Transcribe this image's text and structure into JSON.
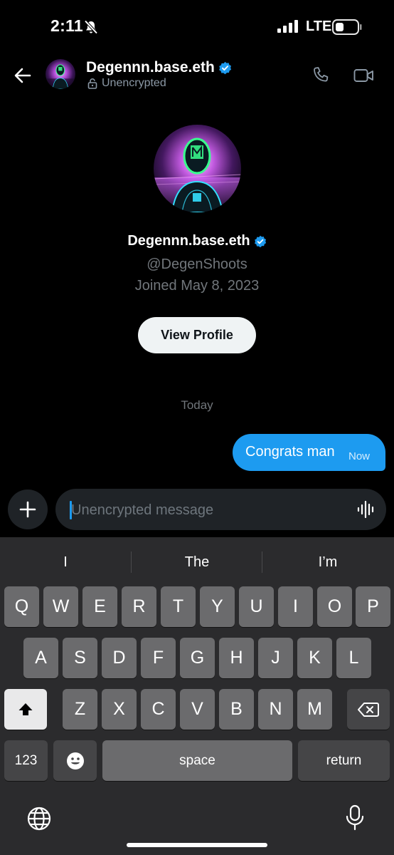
{
  "status": {
    "time": "2:11",
    "network": "LTE",
    "icons": [
      "bell-slash-icon",
      "signal-icon",
      "battery-icon"
    ]
  },
  "header": {
    "name": "Degennn.base.eth",
    "encryption": "Unencrypted",
    "icons": [
      "back-arrow-icon",
      "verified-badge-icon",
      "lock-icon",
      "phone-icon",
      "video-camera-icon"
    ]
  },
  "profile": {
    "name": "Degennn.base.eth",
    "handle": "@DegenShoots",
    "joined": "Joined May 8, 2023",
    "view_profile_label": "View Profile"
  },
  "conversation": {
    "day_label": "Today",
    "messages": [
      {
        "text": "Congrats man",
        "time": "Now",
        "from_me": true
      }
    ]
  },
  "composer": {
    "placeholder": "Unencrypted message",
    "icons": [
      "plus-icon",
      "voice-wave-icon"
    ]
  },
  "keyboard": {
    "suggestions": [
      "I",
      "The",
      "I’m"
    ],
    "row1": [
      "Q",
      "W",
      "E",
      "R",
      "T",
      "Y",
      "U",
      "I",
      "O",
      "P"
    ],
    "row2": [
      "A",
      "S",
      "D",
      "F",
      "G",
      "H",
      "J",
      "K",
      "L"
    ],
    "row3": [
      "Z",
      "X",
      "C",
      "V",
      "B",
      "N",
      "M"
    ],
    "numbers_label": "123",
    "space_label": "space",
    "return_label": "return",
    "icons": [
      "shift-icon",
      "delete-icon",
      "emoji-icon",
      "globe-icon",
      "microphone-icon"
    ]
  },
  "colors": {
    "background": "#000000",
    "accent": "#1d9bf0",
    "muted_text": "#71767b",
    "keyboard_bg": "#2b2b2d",
    "key": "#6b6b6d"
  }
}
